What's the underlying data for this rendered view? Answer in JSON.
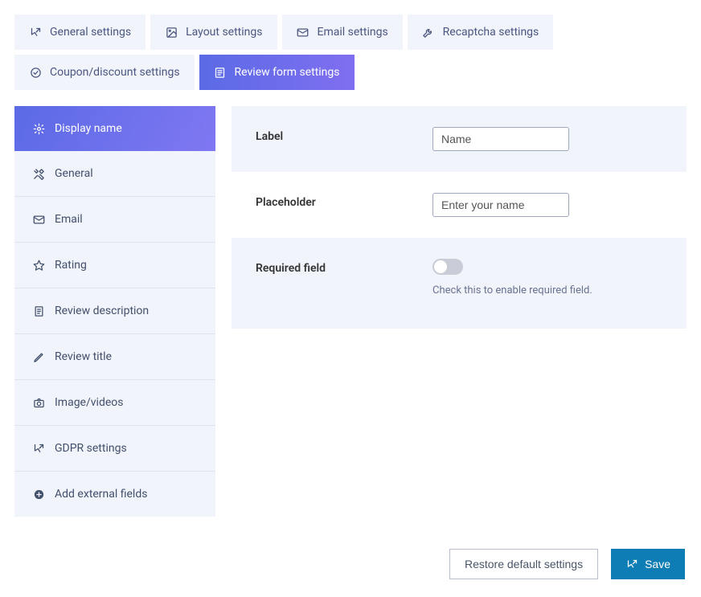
{
  "tabs": [
    {
      "label": "General settings",
      "icon": "settings-arrow"
    },
    {
      "label": "Layout settings",
      "icon": "image"
    },
    {
      "label": "Email settings",
      "icon": "envelope"
    },
    {
      "label": "Recaptcha settings",
      "icon": "wrench"
    },
    {
      "label": "Coupon/discount settings",
      "icon": "tag"
    },
    {
      "label": "Review form settings",
      "icon": "form",
      "active": true
    }
  ],
  "sidebar": [
    {
      "label": "Display name",
      "icon": "gear",
      "active": true
    },
    {
      "label": "General",
      "icon": "tools"
    },
    {
      "label": "Email",
      "icon": "envelope"
    },
    {
      "label": "Rating",
      "icon": "star"
    },
    {
      "label": "Review description",
      "icon": "document"
    },
    {
      "label": "Review title",
      "icon": "pen"
    },
    {
      "label": "Image/videos",
      "icon": "camera"
    },
    {
      "label": "GDPR settings",
      "icon": "settings-arrow"
    },
    {
      "label": "Add external fields",
      "icon": "plus"
    }
  ],
  "fields": {
    "label": {
      "title": "Label",
      "value": "Name"
    },
    "placeholder": {
      "title": "Placeholder",
      "value": "Enter your name"
    },
    "required": {
      "title": "Required field",
      "help": "Check this to enable required field.",
      "checked": false
    }
  },
  "footer": {
    "restore": "Restore default settings",
    "save": "Save"
  }
}
